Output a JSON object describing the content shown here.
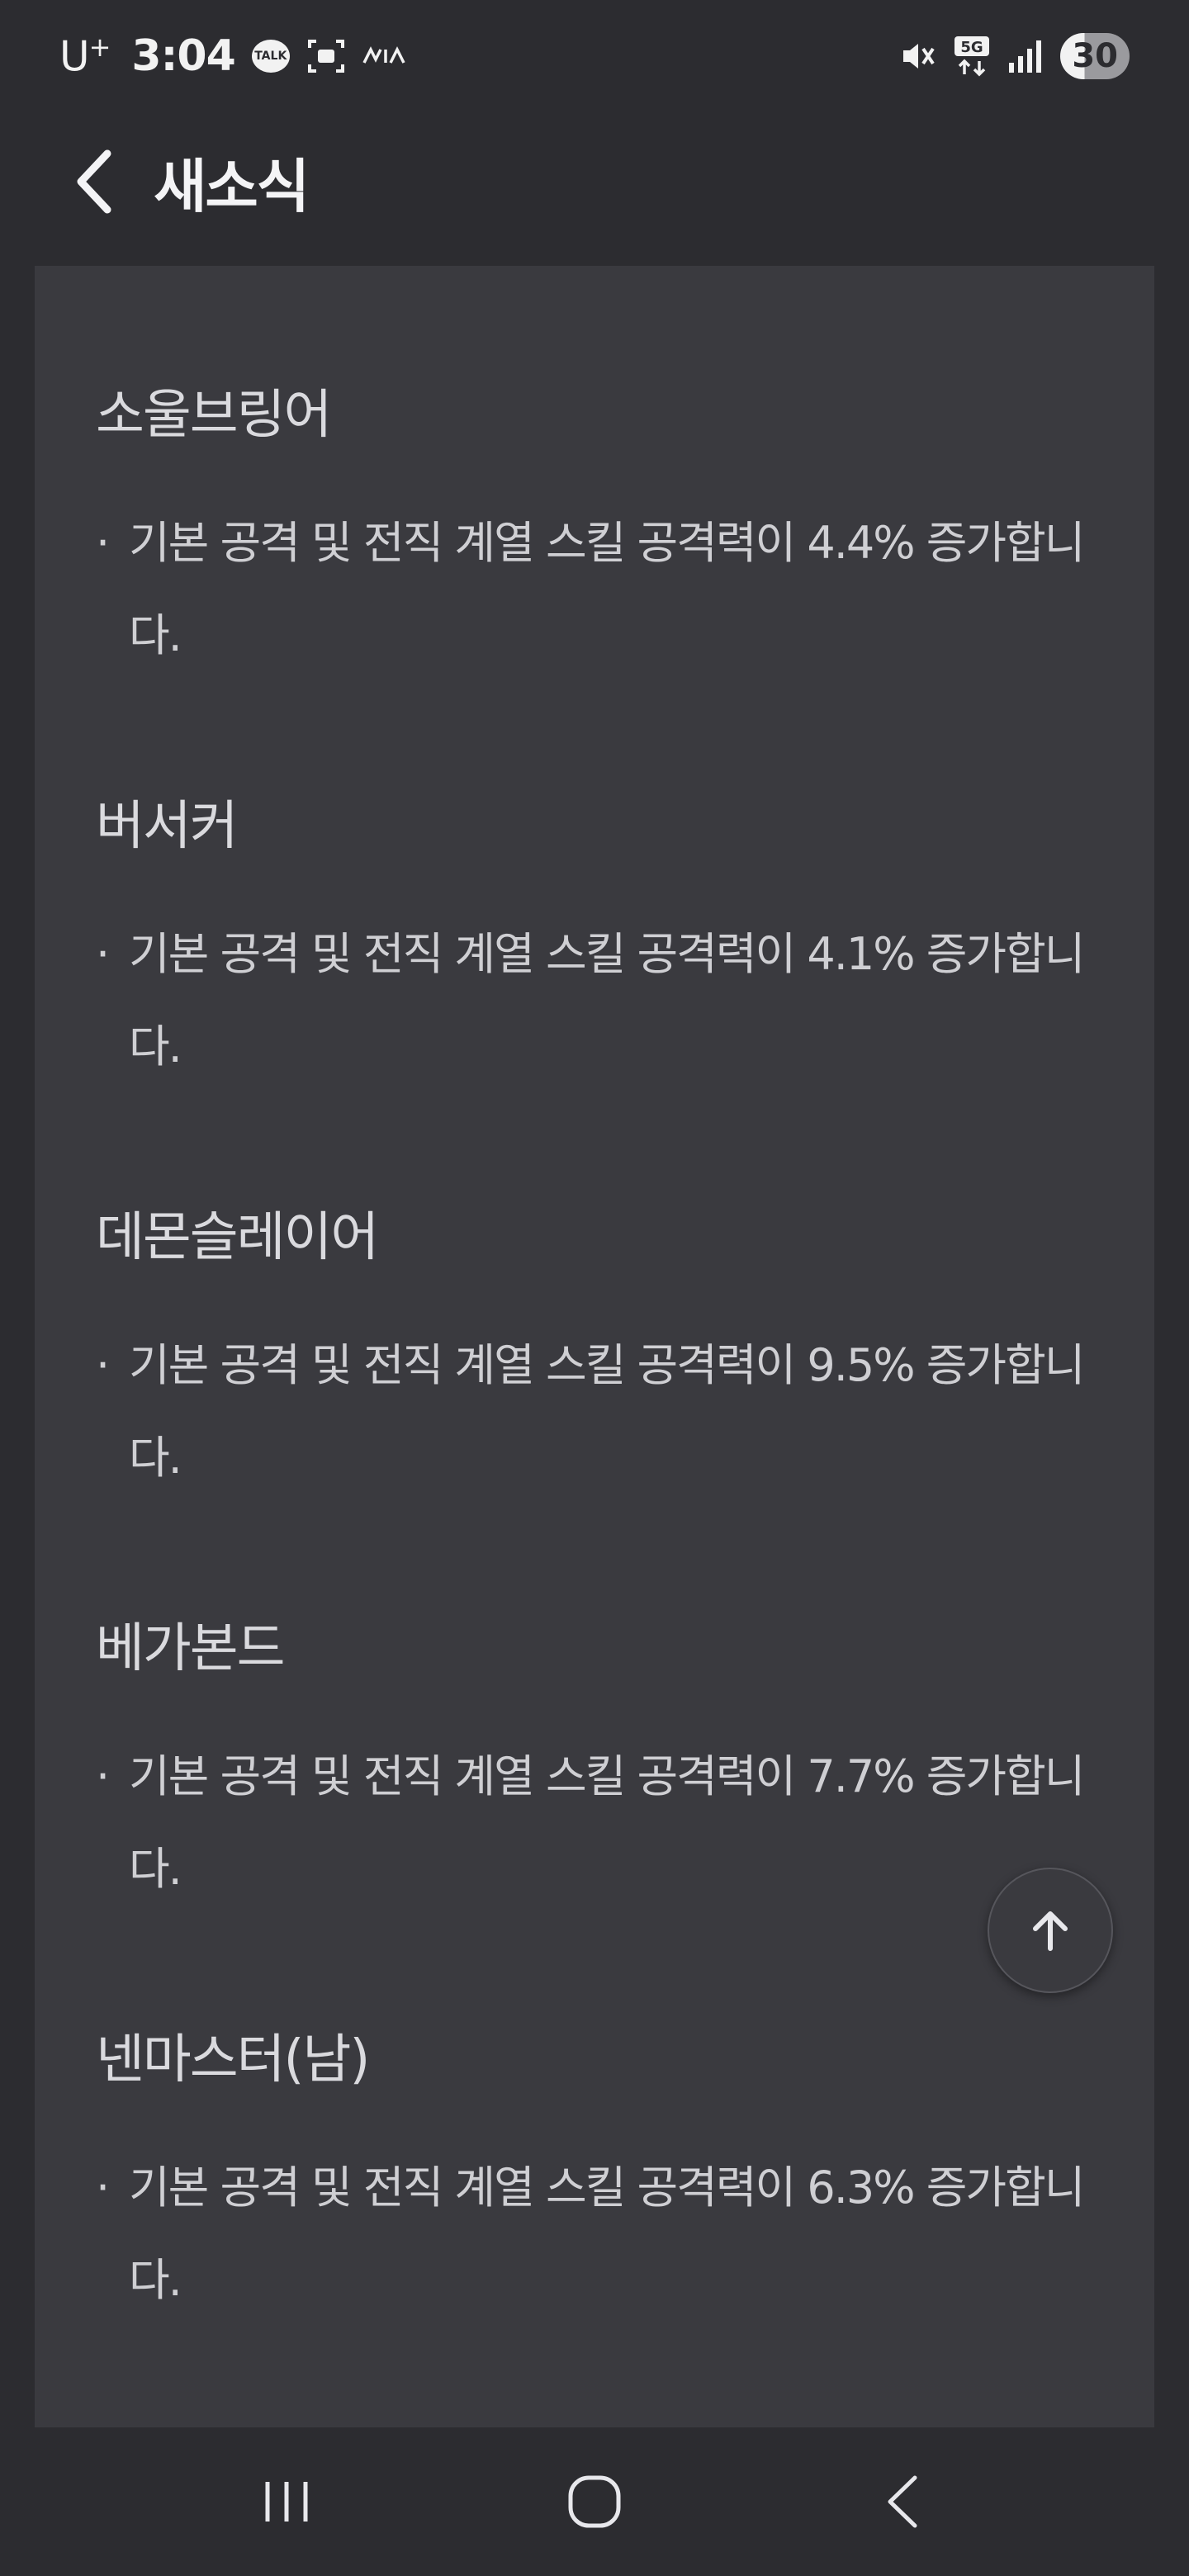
{
  "status_bar": {
    "carrier": "U",
    "carrier_sup": "+",
    "time": "3:04",
    "talk_badge": "TALK",
    "network": "5G",
    "battery": "30",
    "icons": [
      "kakaotalk-icon",
      "screenshot-icon",
      "kia-logo-icon",
      "mute-icon",
      "5g-icon",
      "signal-icon",
      "battery-icon"
    ]
  },
  "header": {
    "title": "새소식",
    "back_icon": "chevron-left-icon"
  },
  "jobs": [
    {
      "name": "소울브링어",
      "description": "기본 공격 및 전직 계열 스킬 공격력이 4.4% 증가합니다."
    },
    {
      "name": "버서커",
      "description": "기본 공격 및 전직 계열 스킬 공격력이 4.1% 증가합니다."
    },
    {
      "name": "데몬슬레이어",
      "description": "기본 공격 및 전직 계열 스킬 공격력이 9.5% 증가합니다."
    },
    {
      "name": "베가본드",
      "description": "기본 공격 및 전직 계열 스킬 공격력이 7.7% 증가합니다."
    },
    {
      "name": "넨마스터(남)",
      "description": "기본 공격 및 전직 계열 스킬 공격력이 6.3% 증가합니다."
    }
  ],
  "fab": {
    "icon": "arrow-up-icon"
  },
  "nav_bar": {
    "icons": [
      "recent-apps-icon",
      "home-icon",
      "back-icon"
    ]
  },
  "colors": {
    "background": "#2c2c30",
    "card": "#3a3a3f",
    "text": "#d8d8dc"
  }
}
